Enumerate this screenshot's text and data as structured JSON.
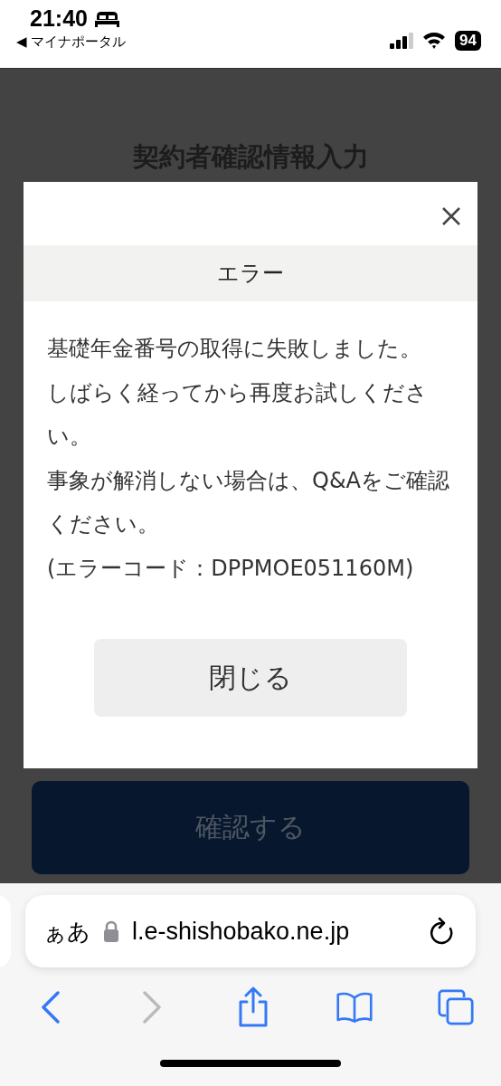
{
  "status_bar": {
    "time": "21:40",
    "back_app": "◀ マイナポータル",
    "battery": "94"
  },
  "page": {
    "title": "契約者確認情報入力",
    "confirm_button": {
      "label": "確認する",
      "disabled": true
    }
  },
  "dialog": {
    "title": "エラー",
    "message": [
      "基礎年金番号の取得に失敗しました。",
      "しばらく経ってから再度お試しください。",
      "事象が解消しない場合は、Q&Aをご確認ください。",
      "(エラーコード：DPPMOE051160M)"
    ],
    "close_button": "閉じる"
  },
  "browser": {
    "text_size_button": "ぁあ",
    "url": "l.e-shishobako.ne.jp",
    "toolbar": [
      {
        "kind": "back",
        "disabled": false
      },
      {
        "kind": "forward",
        "disabled": true
      },
      {
        "kind": "share",
        "disabled": false
      },
      {
        "kind": "bookmarks",
        "disabled": false
      },
      {
        "kind": "tabs",
        "disabled": false
      }
    ]
  }
}
